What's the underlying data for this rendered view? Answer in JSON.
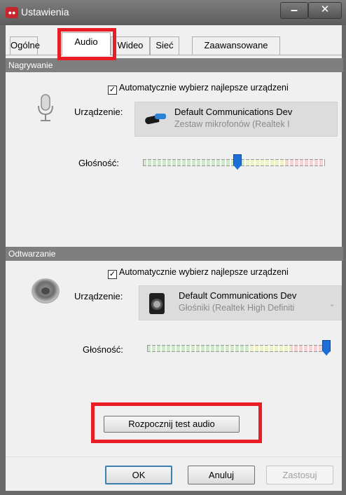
{
  "window": {
    "title": "Ustawienia"
  },
  "tabs": [
    {
      "label": "Ogólne"
    },
    {
      "label": "Audio",
      "active": true
    },
    {
      "label": "Wideo"
    },
    {
      "label": "Sieć"
    },
    {
      "label": "Zaawansowane"
    }
  ],
  "recording": {
    "header": "Nagrywanie",
    "auto_select_label": "Automatycznie wybierz najlepsze urządzeni",
    "auto_select_checked": true,
    "device_label": "Urządzenie:",
    "device_name": "Default Communications Dev",
    "device_sub": "Zestaw mikrofonów (Realtek I",
    "volume_label": "Głośność:",
    "volume_level": 0.52
  },
  "playback": {
    "header": "Odtwarzanie",
    "auto_select_label": "Automatycznie wybierz najlepsze urządzeni",
    "auto_select_checked": true,
    "device_label": "Urządzenie:",
    "device_name": "Default Communications Dev",
    "device_sub": "Głośniki (Realtek High Definiti",
    "volume_label": "Głośność:",
    "volume_level": 1.0
  },
  "test_audio_button": "Rozpocznij test audio",
  "footer": {
    "ok": "OK",
    "cancel": "Anuluj",
    "apply": "Zastosuj"
  },
  "icons": {
    "app": "app-icon",
    "microphone": "microphone-icon",
    "speaker": "speaker-icon",
    "checkbox": "check-icon"
  },
  "colors": {
    "highlight": "#ea1c24",
    "slider_thumb": "#1c6fd6",
    "section_header": "#7f7f7f"
  }
}
